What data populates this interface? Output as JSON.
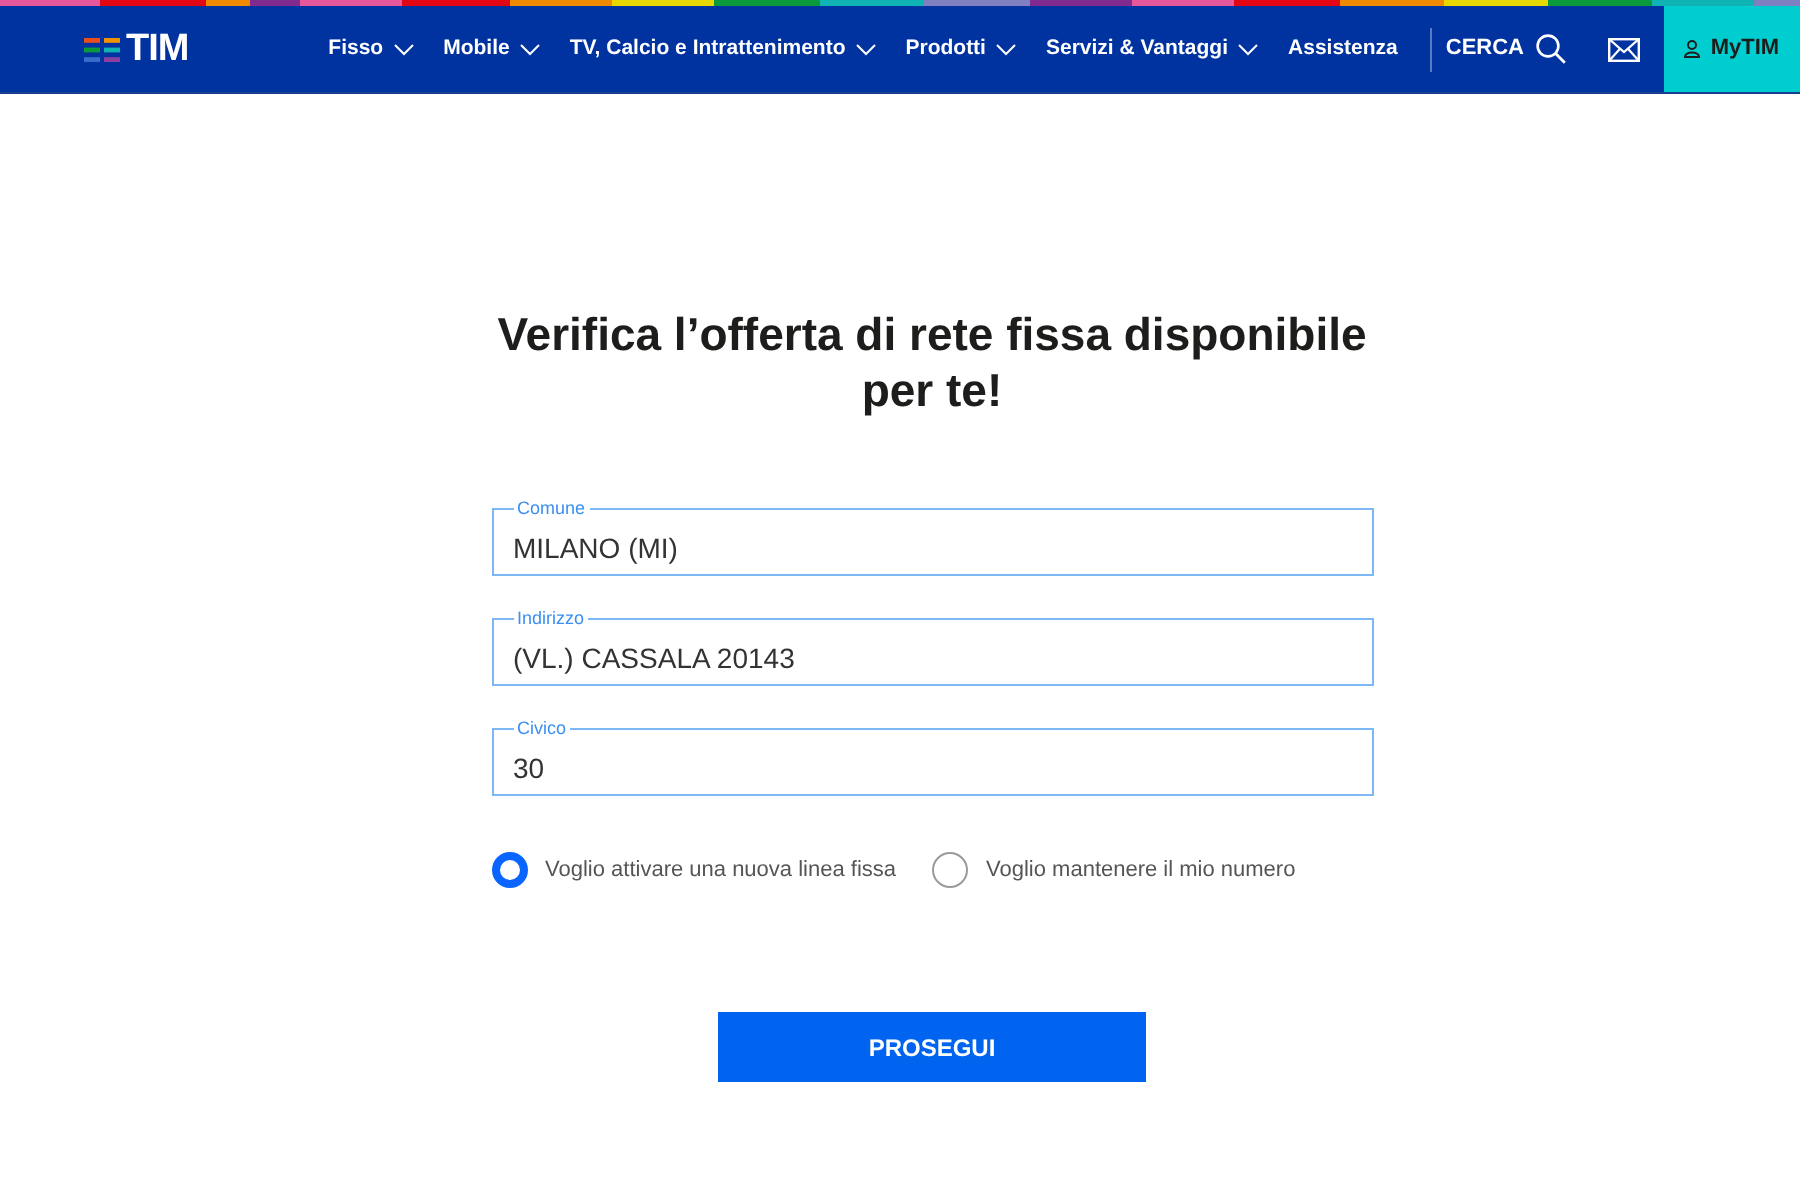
{
  "header": {
    "logo": "TIM",
    "nav": [
      {
        "label": "Fisso",
        "dropdown": true
      },
      {
        "label": "Mobile",
        "dropdown": true
      },
      {
        "label": "TV, Calcio e Intrattenimento",
        "dropdown": true
      },
      {
        "label": "Prodotti",
        "dropdown": true
      },
      {
        "label": "Servizi & Vantaggi",
        "dropdown": true
      },
      {
        "label": "Assistenza",
        "dropdown": false
      }
    ],
    "search_label": "CERCA",
    "account_label": "MyTIM"
  },
  "title": "Verifica l’offerta di rete fissa disponibile per te!",
  "fields": [
    {
      "label": "Comune",
      "value": "MILANO (MI)"
    },
    {
      "label": "Indirizzo",
      "value": "(VL.) CASSALA 20143"
    },
    {
      "label": "Civico",
      "value": "30"
    }
  ],
  "options": [
    {
      "label": "Voglio attivare una nuova linea fissa",
      "selected": true
    },
    {
      "label": "Voglio mantenere il mio numero",
      "selected": false
    }
  ],
  "submit": "PROSEGUI"
}
